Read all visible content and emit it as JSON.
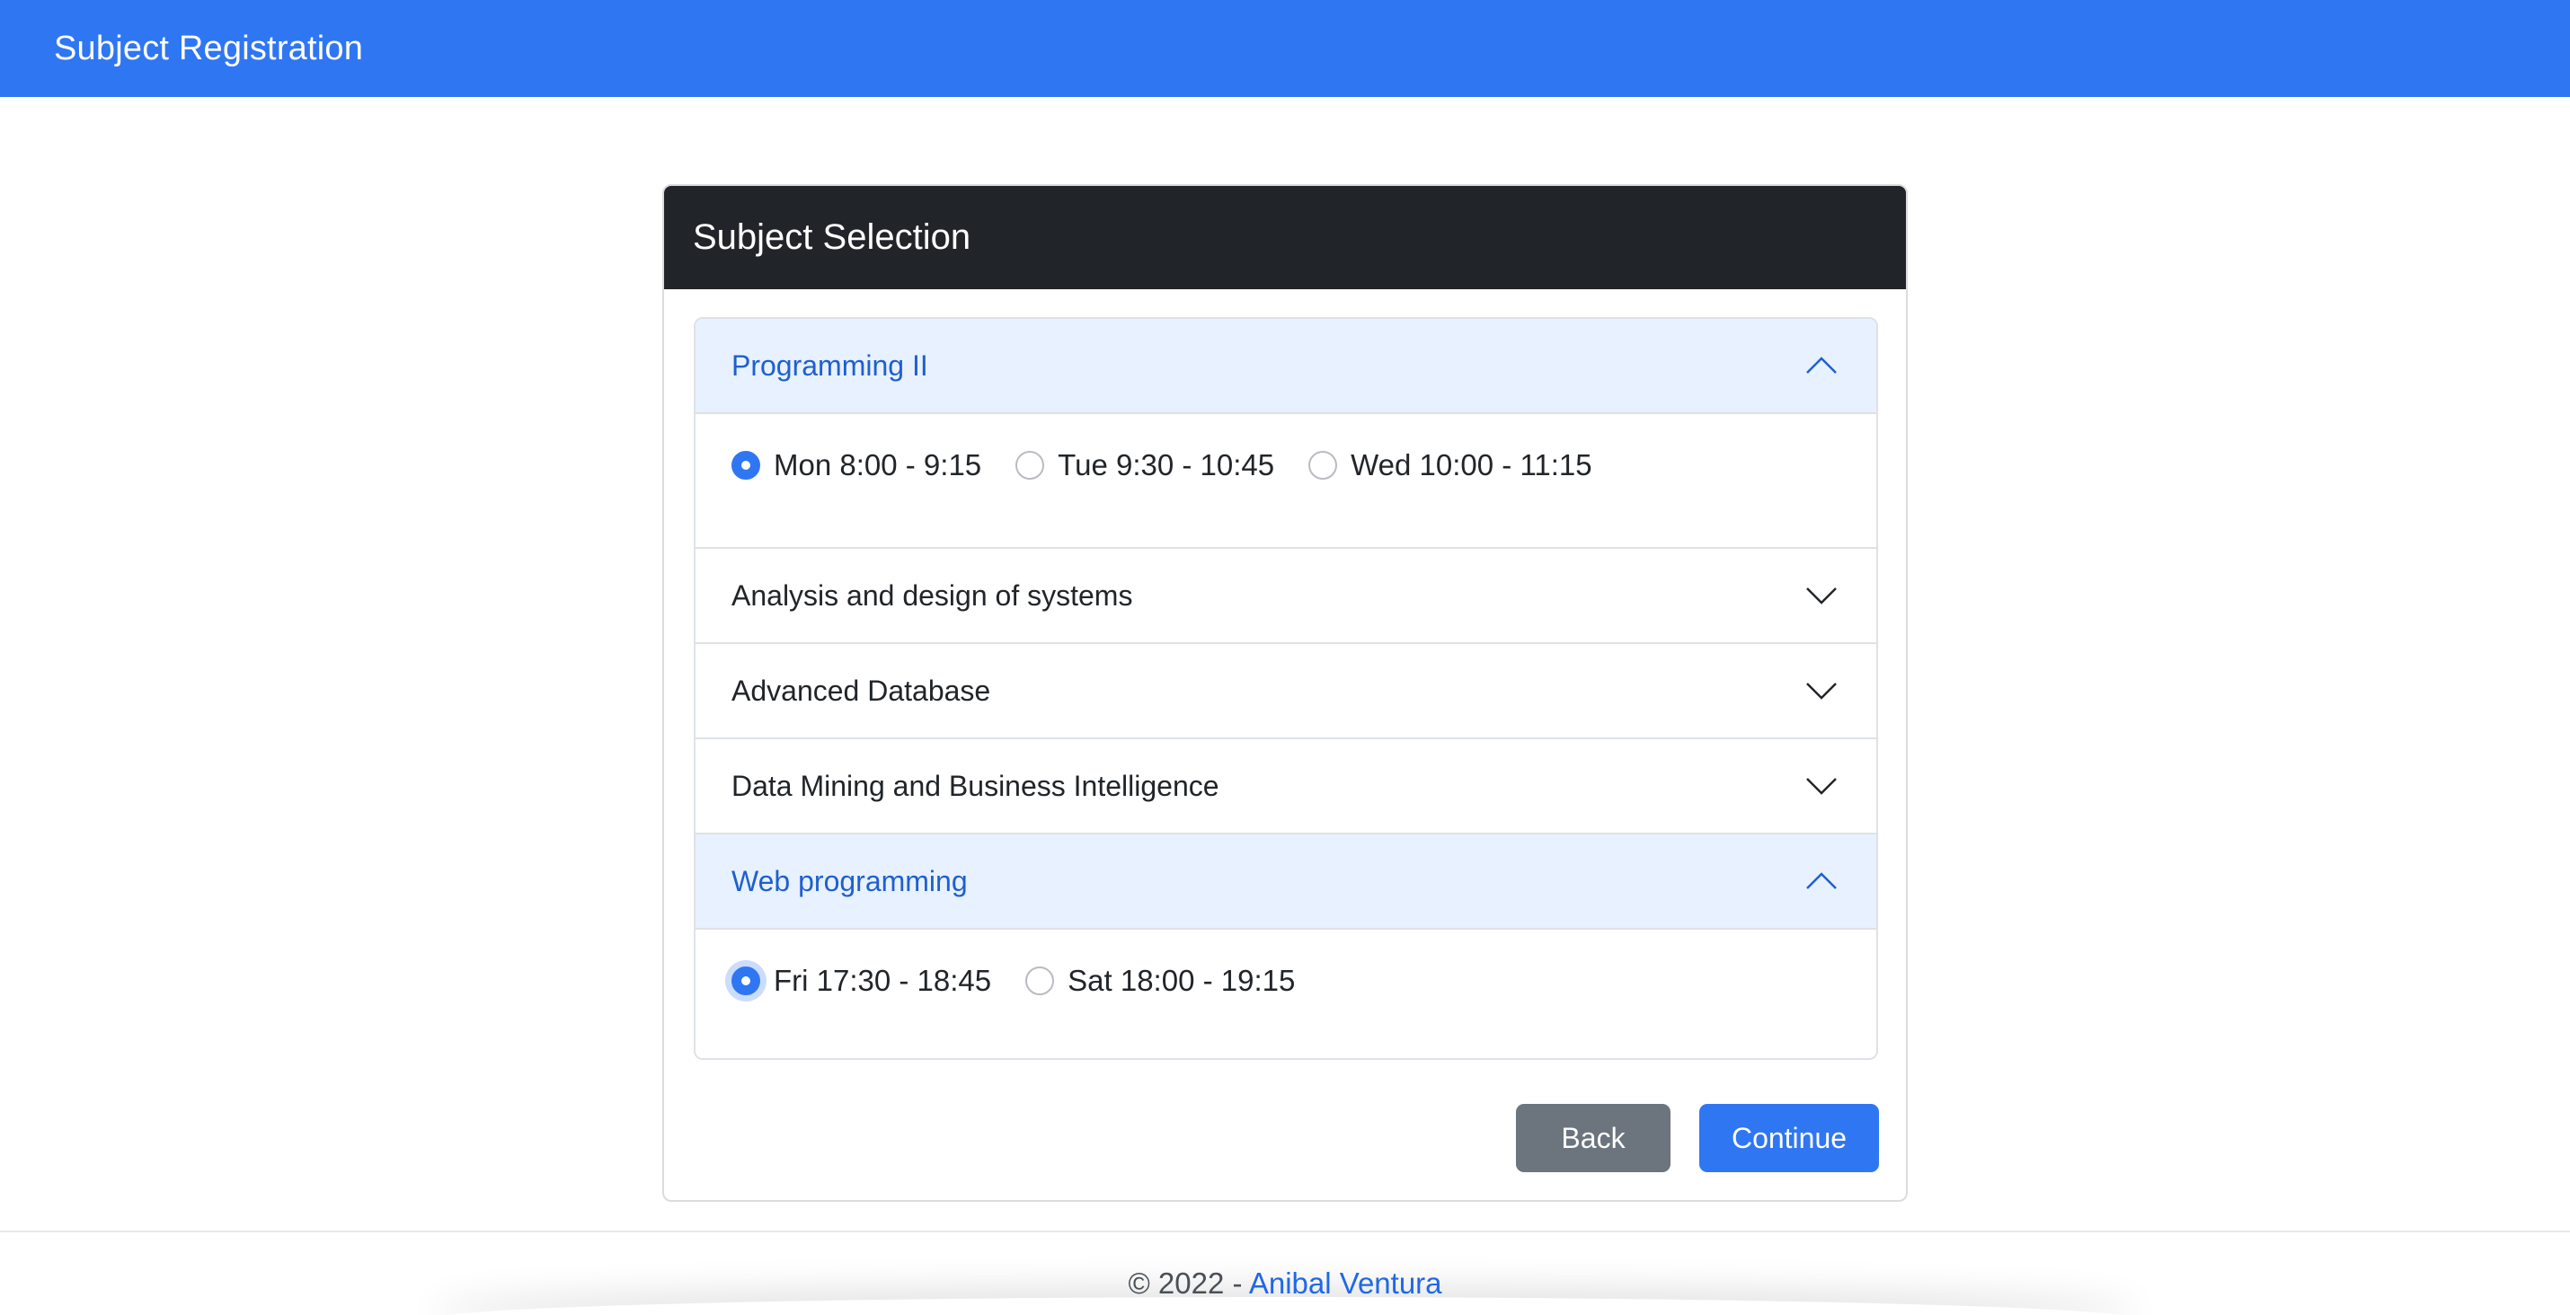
{
  "navbar": {
    "brand": "Subject Registration"
  },
  "card": {
    "title": "Subject Selection",
    "subjects": [
      {
        "name": "Programming II",
        "expanded": true,
        "options": [
          {
            "label": "Mon 8:00 - 9:15",
            "checked": true
          },
          {
            "label": "Tue 9:30 - 10:45",
            "checked": false
          },
          {
            "label": "Wed 10:00 - 11:15",
            "checked": false
          }
        ]
      },
      {
        "name": "Analysis and design of systems",
        "expanded": false
      },
      {
        "name": "Advanced Database",
        "expanded": false
      },
      {
        "name": "Data Mining and Business Intelligence",
        "expanded": false
      },
      {
        "name": "Web programming",
        "expanded": true,
        "options": [
          {
            "label": "Fri 17:30 - 18:45",
            "checked": true
          },
          {
            "label": "Sat 18:00 - 19:15",
            "checked": false
          }
        ]
      }
    ],
    "back_label": "Back",
    "continue_label": "Continue"
  },
  "footer": {
    "copyright": "© 2022 - ",
    "author": "Anibal Ventura"
  },
  "colors": {
    "primary": "#2f76f3",
    "dark": "#212529",
    "secondary": "#6c757d",
    "accordion_open_bg": "#e7f1ff",
    "accordion_open_text": "#1f5fcf"
  },
  "icons": {
    "expanded": "chevron-up-icon",
    "collapsed": "chevron-down-icon"
  }
}
